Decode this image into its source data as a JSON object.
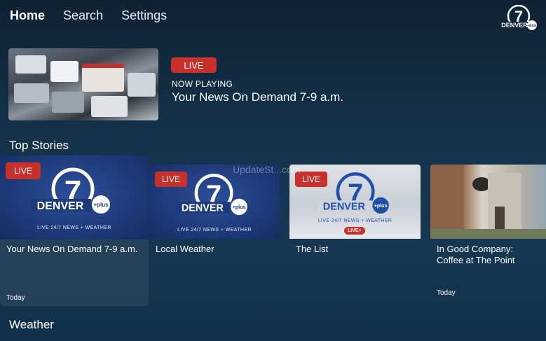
{
  "nav": {
    "items": [
      {
        "label": "Home",
        "active": true
      },
      {
        "label": "Search",
        "active": false
      },
      {
        "label": "Settings",
        "active": false
      }
    ]
  },
  "logo": {
    "text": "DENVER",
    "sub": "+plus",
    "number": "7"
  },
  "now_playing": {
    "badge": "LIVE",
    "label": "NOW PLAYING",
    "title": "Your News On Demand 7-9 a.m."
  },
  "sections": {
    "top_stories": "Top Stories",
    "weather": "Weather"
  },
  "watermark": "UpdateSt...com",
  "cards": [
    {
      "badge": "LIVE",
      "title": "Your News On Demand 7-9 a.m.",
      "date": "Today",
      "tagline": "LIVE 24/7 NEWS + WEATHER"
    },
    {
      "badge": "LIVE",
      "title": "Local Weather",
      "date": "",
      "tagline": "LIVE 24/7 NEWS + WEATHER"
    },
    {
      "badge": "LIVE",
      "title": "The List",
      "date": "",
      "tagline": "LIVE 24/7 NEWS + WEATHER",
      "live_plus": "LIVE+"
    },
    {
      "badge": "",
      "title": "In Good Company: Coffee at The Point",
      "date": "Today"
    }
  ],
  "colors": {
    "live_red": "#c8302b",
    "bg_top": "#0e2233",
    "bg_bottom": "#163752",
    "focus_card": "#25415a"
  }
}
